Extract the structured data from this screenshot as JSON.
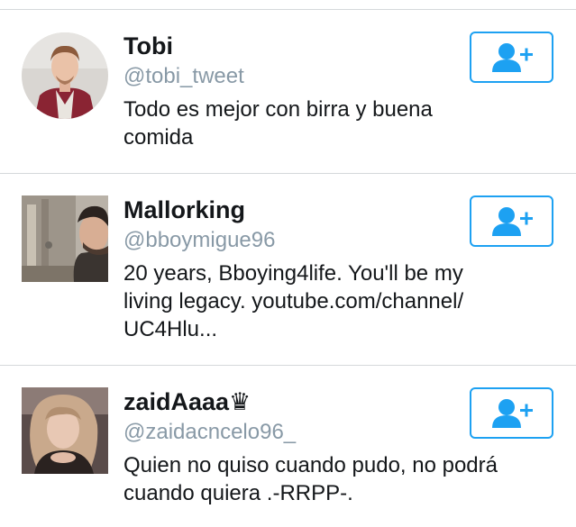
{
  "users": [
    {
      "name": "Tobi",
      "handle": "@tobi_tweet",
      "bio_lines": [
        "Todo es mejor con birra y buena",
        "comida"
      ],
      "follow_icon": "add-user-icon"
    },
    {
      "name": "Mallorking",
      "handle": "@bboymigue96",
      "bio_lines": [
        "20 years, Bboying4life. You'll be my",
        "living legacy. youtube.com/channel/",
        "UC4Hlu..."
      ],
      "follow_icon": "add-user-icon"
    },
    {
      "name": "zaidAaaa♛",
      "handle": "@zaidacncelo96_",
      "bio_lines": [
        "Quien no quiso cuando pudo, no podrá",
        "cuando quiera .-RRPP-."
      ],
      "follow_icon": "add-user-icon"
    }
  ],
  "colors": {
    "accent": "#1da1f2",
    "handle": "#8899a6",
    "text": "#14171a",
    "divider": "#d5d8db"
  }
}
